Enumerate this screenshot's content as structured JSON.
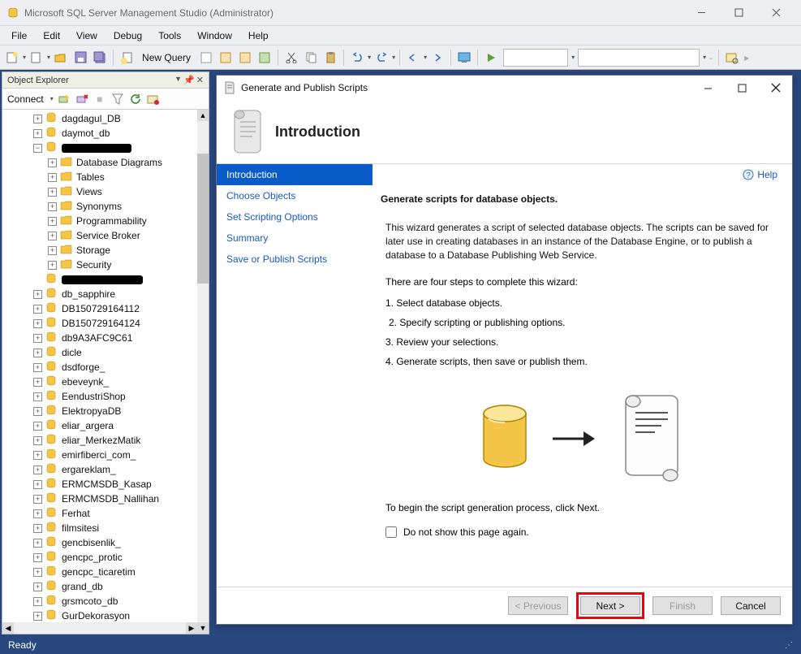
{
  "window": {
    "title": "Microsoft SQL Server Management Studio (Administrator)"
  },
  "menubar": [
    "File",
    "Edit",
    "View",
    "Debug",
    "Tools",
    "Window",
    "Help"
  ],
  "toolbar": {
    "new_query": "New Query"
  },
  "panel": {
    "title": "Object Explorer",
    "connect": "Connect"
  },
  "tree": {
    "db_nodes_top": [
      "dagdagul_DB",
      "daymot_db"
    ],
    "expanded_children": [
      "Database Diagrams",
      "Tables",
      "Views",
      "Synonyms",
      "Programmability",
      "Service Broker",
      "Storage",
      "Security"
    ],
    "db_nodes_rest": [
      "db_sapphire",
      "DB150729164112",
      "DB150729164124",
      "db9A3AFC9C61",
      "dicle",
      "dsdforge_",
      "ebeveynk_",
      "EendustriShop",
      "ElektropyaDB",
      "eliar_argera",
      "eliar_MerkezMatik",
      "emirfiberci_com_",
      "ergareklam_",
      "ERMCMSDB_Kasap",
      "ERMCMSDB_Nallihan",
      "Ferhat",
      "filmsitesi",
      "gencbisenlik_",
      "gencpc_protic",
      "gencpc_ticaretim",
      "grand_db",
      "grsmcoto_db",
      "GurDekorasyon"
    ]
  },
  "dialog": {
    "title": "Generate and Publish Scripts",
    "page_title": "Introduction",
    "help": "Help",
    "nav": [
      "Introduction",
      "Choose Objects",
      "Set Scripting Options",
      "Summary",
      "Save or Publish Scripts"
    ],
    "heading": "Generate scripts for database objects.",
    "para": "This wizard generates a script of selected database objects. The scripts can be saved for later use in creating databases in an instance of the Database Engine, or to publish a database to a Database Publishing Web Service.",
    "steps_intro": "There are four steps to complete this wizard:",
    "steps": [
      "1. Select database objects.",
      "2. Specify scripting or publishing options.",
      "3. Review your selections.",
      "4. Generate scripts, then save or publish them."
    ],
    "begin": "To begin the script generation process, click Next.",
    "checkbox": "Do not show this page again.",
    "buttons": {
      "prev": "< Previous",
      "next": "Next >",
      "finish": "Finish",
      "cancel": "Cancel"
    }
  },
  "status": {
    "ready": "Ready"
  }
}
